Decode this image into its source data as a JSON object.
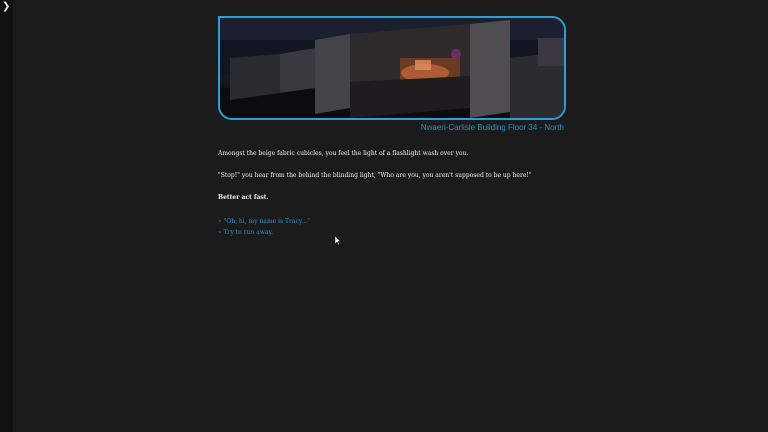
{
  "sidebar": {
    "toggle_icon": "chevron-right-icon",
    "toggle_glyph": "❯"
  },
  "passage": {
    "image": {
      "subject": "dark office cubicles lit by a lamp",
      "border_color": "#2b9fd8"
    },
    "location": "Nwaeri-Carlisle Building Floor 34 - North",
    "paragraphs": [
      "Amongst the beige fabric cubicles, you feel the light of a flashlight wash over you.",
      "\"Stop!\" you hear from the behind the blinding light, \"Who are you, you aren't supposed to be up here!\""
    ],
    "emphasis": "Better act fast.",
    "choices": [
      "» \"Oh, hi, my name is Tracy...\"",
      "» Try to run away."
    ]
  },
  "colors": {
    "background": "#1b1b1b",
    "sidebar": "#111111",
    "link": "#2e8fc7",
    "text": "#f2f2f2"
  }
}
